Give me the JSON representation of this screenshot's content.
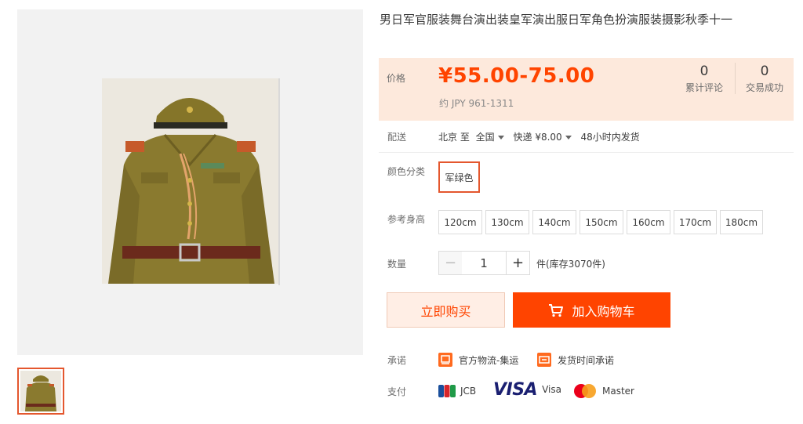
{
  "product": {
    "title": "男日军官服装舞台演出装皇军演出服日军角色扮演服装摄影秋季十一"
  },
  "price": {
    "label": "价格",
    "value": "¥55.00-75.00",
    "converted": "约 JPY 961-1311"
  },
  "stats": {
    "reviews_count": "0",
    "reviews_label": "累计评论",
    "sales_count": "0",
    "sales_label": "交易成功"
  },
  "shipping": {
    "label": "配送",
    "from": "北京 至",
    "to": "全国",
    "method": "快递 ¥8.00",
    "dispatch": "48小时内发货"
  },
  "color": {
    "label": "颜色分类",
    "selected": "军绿色"
  },
  "size": {
    "label": "参考身高",
    "options": [
      "120cm",
      "130cm",
      "140cm",
      "150cm",
      "160cm",
      "170cm",
      "180cm"
    ]
  },
  "quantity": {
    "label": "数量",
    "minus": "−",
    "value": "1",
    "plus": "+",
    "stock": "件(库存3070件)"
  },
  "actions": {
    "buy_now": "立即购买",
    "add_to_cart": "加入购物车"
  },
  "promise": {
    "label": "承诺",
    "items": [
      "官方物流-集运",
      "发货时间承诺"
    ]
  },
  "payment": {
    "label": "支付",
    "methods": [
      "JCB",
      "VISA",
      "Visa",
      "Master"
    ]
  },
  "colors": {
    "accent": "#ff4400",
    "price_bg": "#fde9dc",
    "selected_border": "#e4572e"
  }
}
